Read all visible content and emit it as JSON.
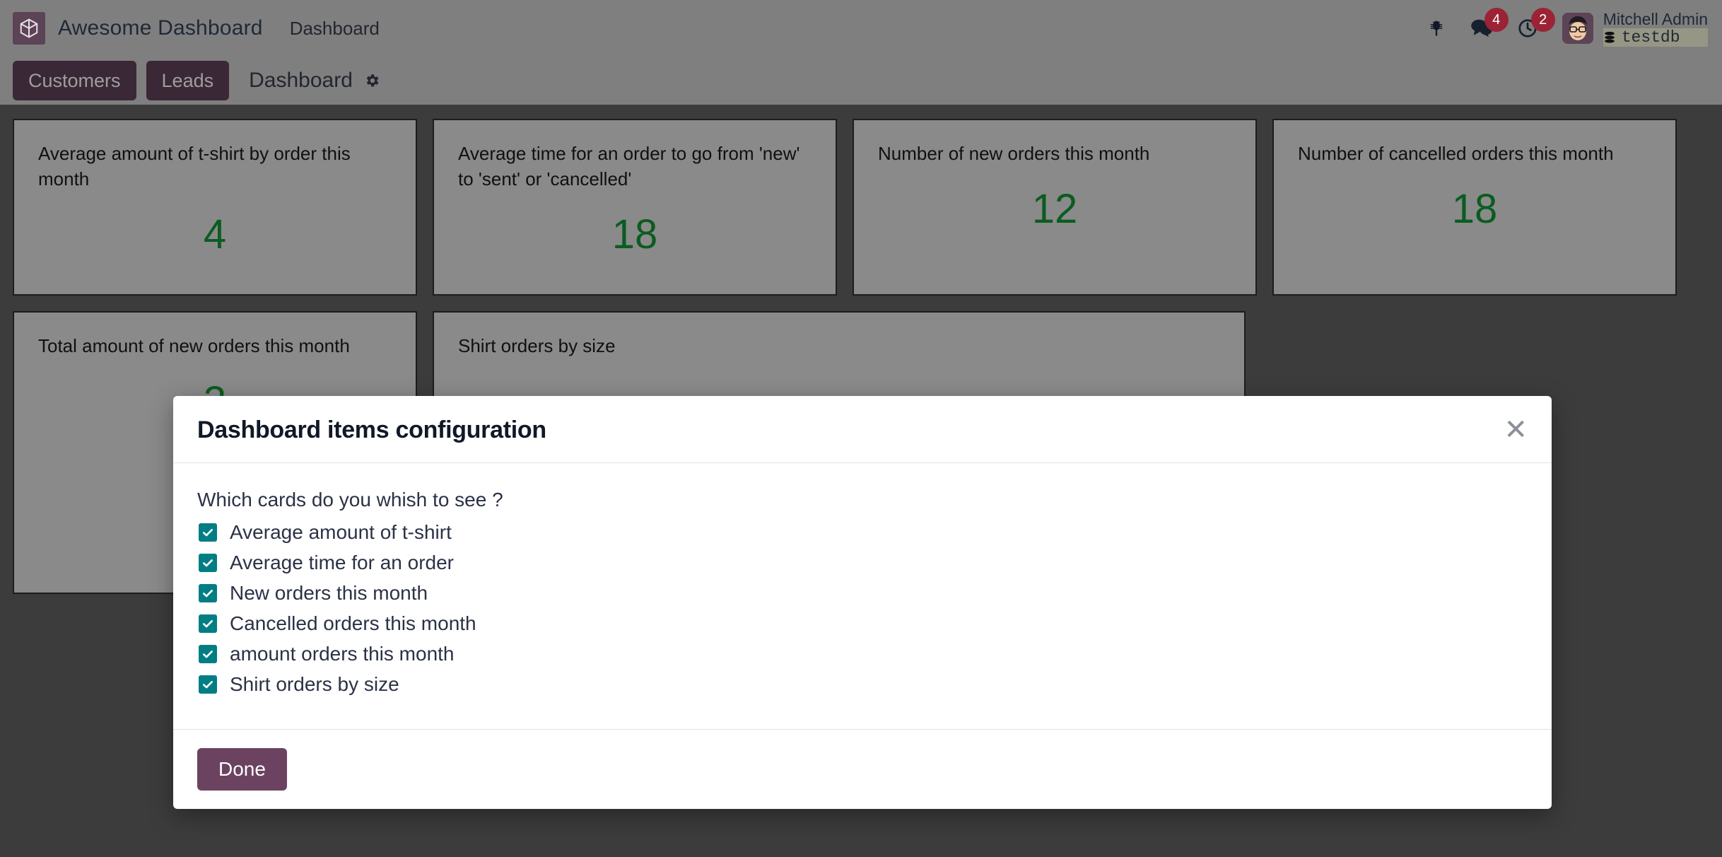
{
  "navbar": {
    "brand": "Awesome Dashboard",
    "menu_item": "Dashboard",
    "logo_icon": "cube-box-icon",
    "bug_icon": "bug-icon",
    "messages_icon": "chat-bubbles-icon",
    "messages_count": "4",
    "activities_icon": "clock-icon",
    "activities_count": "2",
    "avatar_icon": "user-avatar",
    "user_name": "Mitchell Admin",
    "database_icon": "database-icon",
    "database_name": "testdb"
  },
  "control_panel": {
    "customers_label": "Customers",
    "leads_label": "Leads",
    "title": "Dashboard",
    "settings_icon": "gear-icon"
  },
  "cards": [
    {
      "title": "Average amount of t-shirt by order this month",
      "value": "4"
    },
    {
      "title": "Average time for an order to go from 'new' to 'sent' or 'cancelled'",
      "value": "18"
    },
    {
      "title": "Number of new orders this month",
      "value": "12"
    },
    {
      "title": "Number of cancelled orders this month",
      "value": "18"
    },
    {
      "title": "Total amount of new orders this month",
      "value": "3"
    },
    {
      "title": "Shirt orders by size",
      "value": ""
    }
  ],
  "modal": {
    "title": "Dashboard items configuration",
    "close_icon": "close-icon",
    "question": "Which cards do you whish to see ?",
    "options": [
      {
        "label": "Average amount of t-shirt",
        "checked": true
      },
      {
        "label": "Average time for an order",
        "checked": true
      },
      {
        "label": "New orders this month",
        "checked": true
      },
      {
        "label": "Cancelled orders this month",
        "checked": true
      },
      {
        "label": "amount orders this month",
        "checked": true
      },
      {
        "label": "Shirt orders by size",
        "checked": true
      }
    ],
    "done_label": "Done"
  },
  "colors": {
    "brand_purple": "#6b4360",
    "accent_teal": "#017e84",
    "value_green": "#0b5c20",
    "badge_red": "#9b2335",
    "navbar_gray": "#7f7f7f",
    "dash_bg": "#3c3c3c",
    "card_bg": "#8a8a8a"
  }
}
